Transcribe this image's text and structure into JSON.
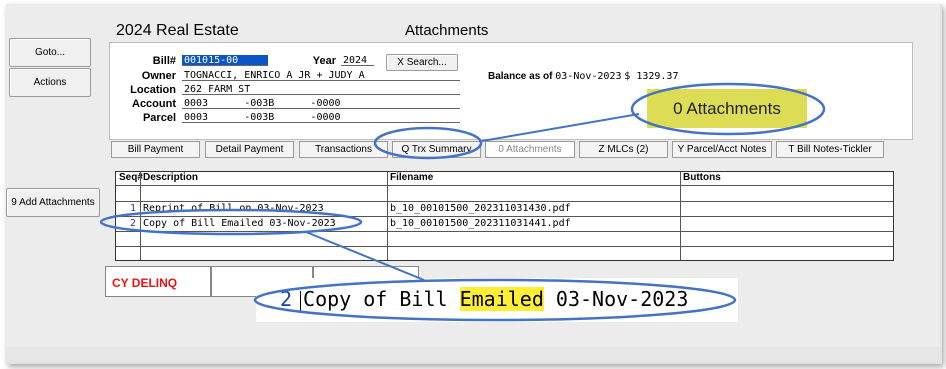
{
  "header": {
    "module_title": "2024 Real Estate",
    "screen_title": "Attachments"
  },
  "side_buttons": {
    "goto": "Goto...",
    "actions": "Actions",
    "add_attachments": "9 Add Attachments"
  },
  "fields": {
    "bill_label": "Bill#",
    "bill_value": "001015-00",
    "year_label": "Year",
    "year_value": "2024",
    "search_button": "X Search...",
    "owner_label": "Owner",
    "owner_value": "TOGNACCI, ENRICO A JR + JUDY A",
    "location_label": "Location",
    "location_value": "262 FARM ST",
    "account_label": "Account",
    "account_value": "0003      -003B      -0000",
    "parcel_label": "Parcel",
    "parcel_value": "0003      -003B      -0000"
  },
  "balance": {
    "label": "Balance as of",
    "date": "03-Nov-2023",
    "amount": "$ 1329.37"
  },
  "callout_attachments": "0 Attachments",
  "tabs": [
    {
      "label": "Bill Payment"
    },
    {
      "label": "Detail Payment"
    },
    {
      "label": "Transactions"
    },
    {
      "label": "Q Trx Summary"
    },
    {
      "label": "0 Attachments"
    },
    {
      "label": "Z MLCs (2)"
    },
    {
      "label": "Y Parcel/Acct Notes"
    },
    {
      "label": "T Bill Notes-Tickler"
    }
  ],
  "grid": {
    "headers": {
      "seq": "Seq#",
      "description": "Description",
      "filename": "Filename",
      "buttons": "Buttons"
    },
    "rows": [
      {
        "seq": "1",
        "description": "Reprint of Bill on 03-Nov-2023",
        "filename": "b_10_00101500_202311031430.pdf"
      },
      {
        "seq": "2",
        "description": "Copy of Bill Emailed 03-Nov-2023",
        "filename": "b_10_00101500_202311031441.pdf"
      }
    ]
  },
  "status": {
    "cy_delinq": "CY DELINQ"
  },
  "zoom_callout": {
    "seq": "2",
    "before": "Copy of Bill ",
    "highlight": "Emailed",
    "after": " 03-Nov-2023"
  },
  "colors": {
    "accent_blue": "#4472c4",
    "highlight_yellow": "#ffee33",
    "callout_yellow": "#dddd55",
    "status_red": "#ee1111"
  }
}
